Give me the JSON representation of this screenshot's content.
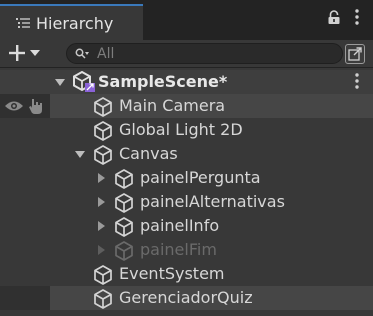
{
  "panel": {
    "title": "Hierarchy",
    "lock_icon": "lock-icon",
    "menu_icon": "kebab-menu-icon"
  },
  "toolbar": {
    "add_icon": "plus-icon",
    "search_placeholder": "All",
    "search_value": ""
  },
  "tree": [
    {
      "label": "SampleScene*",
      "type": "scene",
      "expanded": true
    },
    {
      "label": "Main Camera",
      "depth": 1,
      "has_children": false,
      "selected_hover": true
    },
    {
      "label": "Global Light 2D",
      "depth": 1,
      "has_children": false
    },
    {
      "label": "Canvas",
      "depth": 1,
      "has_children": true,
      "expanded": true
    },
    {
      "label": "painelPergunta",
      "depth": 2,
      "has_children": true,
      "expanded": false
    },
    {
      "label": "painelAlternativas",
      "depth": 2,
      "has_children": true,
      "expanded": false
    },
    {
      "label": "painelInfo",
      "depth": 2,
      "has_children": true,
      "expanded": false
    },
    {
      "label": "painelFim",
      "depth": 2,
      "has_children": true,
      "expanded": false,
      "inactive": true
    },
    {
      "label": "EventSystem",
      "depth": 1,
      "has_children": false
    },
    {
      "label": "GerenciadorQuiz",
      "depth": 1,
      "has_children": false,
      "highlighted": true
    }
  ],
  "colors": {
    "background": "#383838",
    "tab_accent": "#3a79bb",
    "scene_badge": "#8a62d8"
  }
}
